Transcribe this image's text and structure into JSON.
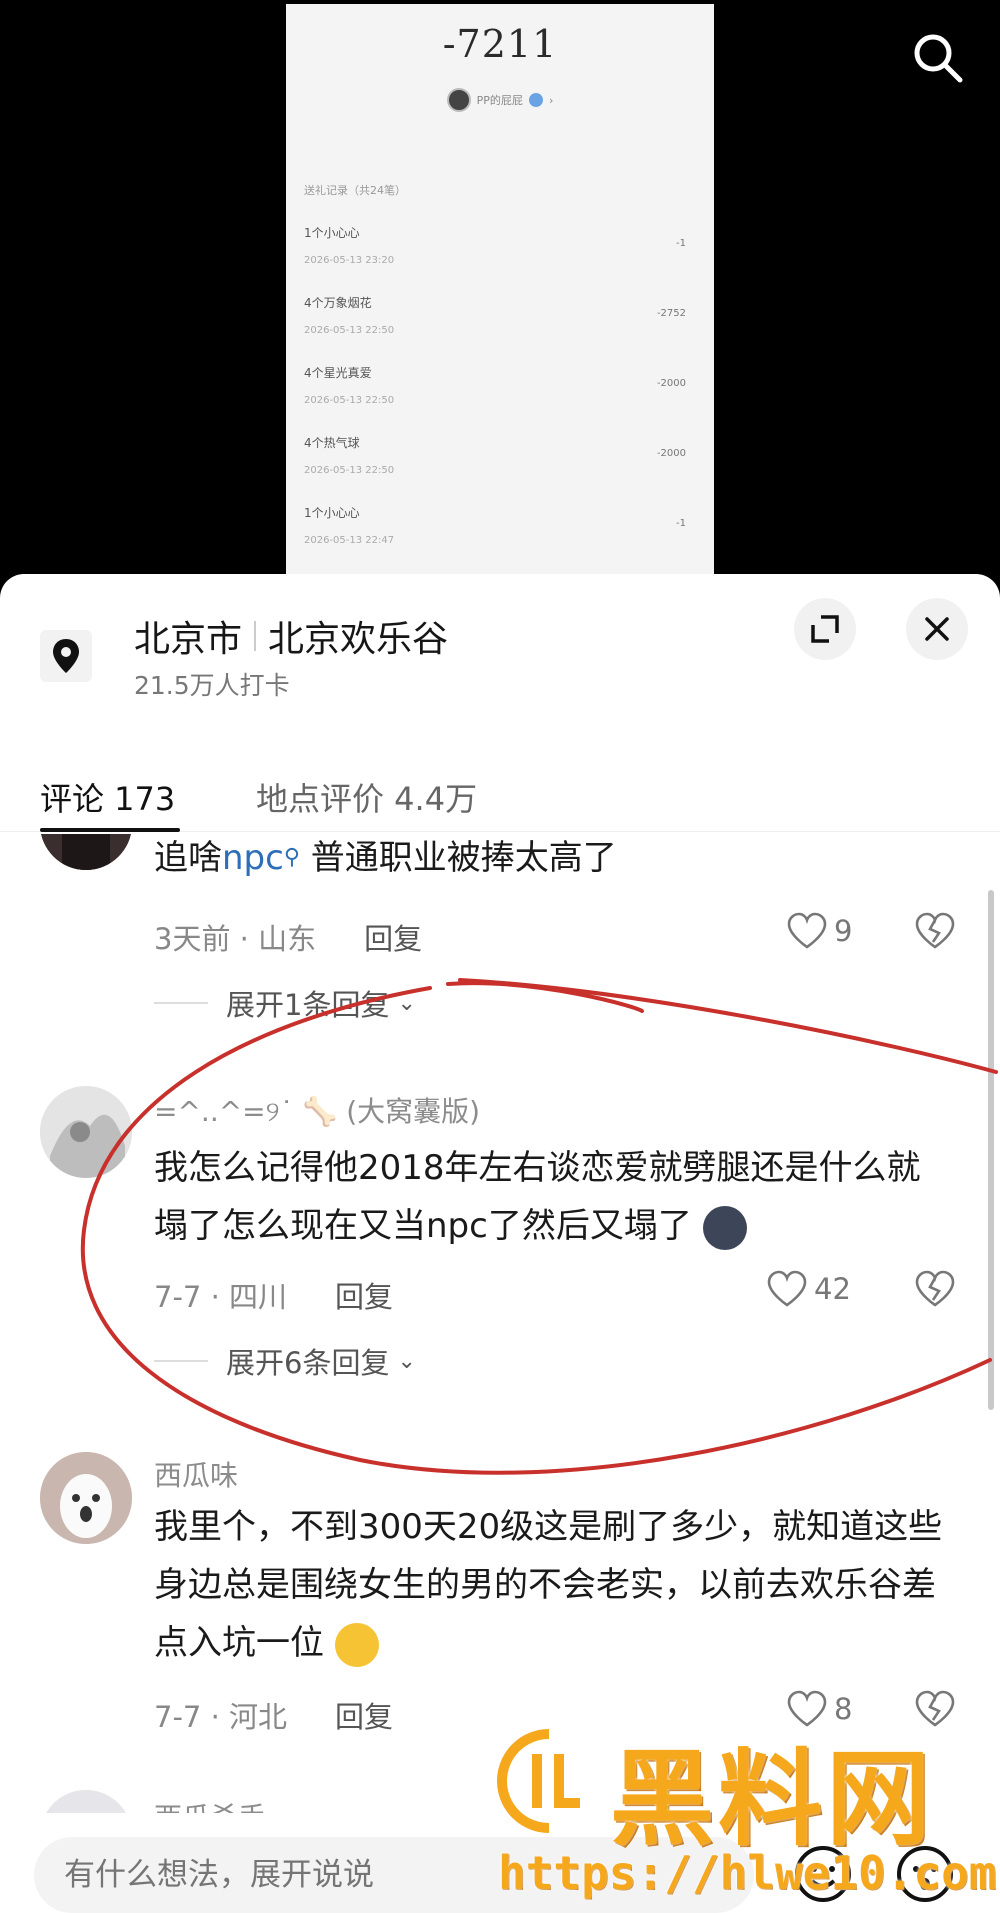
{
  "receipt": {
    "amount": "-7211",
    "owner": "PP的屁屁",
    "record_title": "送礼记录（共24笔）",
    "items": [
      {
        "name": "1个小心心",
        "time": "2026-05-13 23:20",
        "value": "-1"
      },
      {
        "name": "4个万象烟花",
        "time": "2026-05-13 22:50",
        "value": "-2752"
      },
      {
        "name": "4个星光真爱",
        "time": "2026-05-13 22:50",
        "value": "-2000"
      },
      {
        "name": "4个热气球",
        "time": "2026-05-13 22:50",
        "value": "-2000"
      },
      {
        "name": "1个小心心",
        "time": "2026-05-13 22:47",
        "value": "-1"
      }
    ]
  },
  "location": {
    "city": "北京市",
    "place": "北京欢乐谷",
    "checkins": "21.5万人打卡"
  },
  "tabs": {
    "comments": "评论 173",
    "reviews": "地点评价 4.4万"
  },
  "comments": [
    {
      "text_prefix": "追啥",
      "keyword": "npc",
      "text_suffix": " 普通职业被捧太高了",
      "meta": "3天前 · 山东",
      "reply_label": "回复",
      "likes": "9",
      "expand_label": "展开1条回复"
    },
    {
      "user": "=^..^=୨˙ 🦴 (大窝囊版)",
      "text": "我怎么记得他2018年左右谈恋爱就劈腿还是什么就塌了怎么现在又当npc了然后又塌了",
      "meta": "7-7 · 四川",
      "reply_label": "回复",
      "likes": "42",
      "expand_label": "展开6条回复"
    },
    {
      "user": "西瓜味",
      "text": "我里个，不到300天20级这是刷了多少，就知道这些身边总是围绕女生的男的不会老实，以前去欢乐谷差点入坑一位",
      "meta": "7-7 · 河北",
      "reply_label": "回复",
      "likes": "8"
    },
    {
      "user": "西瓜杀手"
    }
  ],
  "input": {
    "placeholder": "有什么想法，展开说说"
  },
  "watermark": {
    "name": "黑料网",
    "url": "https://hlwe10.com"
  },
  "colors": {
    "watermark": "#f6a81d",
    "annotation": "#c8302c",
    "keyword": "#2d6eb6"
  }
}
